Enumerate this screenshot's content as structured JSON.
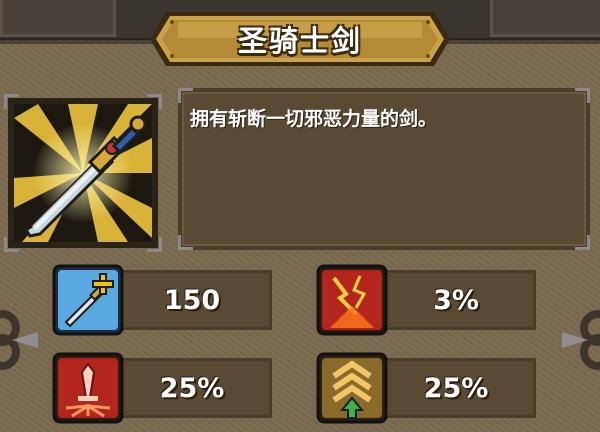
{
  "item": {
    "name": "圣骑士剑",
    "description": "拥有斩断一切邪恶力量的剑。"
  },
  "stats": [
    {
      "icon": "sword-plus-icon",
      "value": "150"
    },
    {
      "icon": "lightning-crit-icon",
      "value": "3%"
    },
    {
      "icon": "bleeding-dagger-icon",
      "value": "25%"
    },
    {
      "icon": "rank-up-chevrons-icon",
      "value": "25%"
    }
  ],
  "colors": {
    "panel": "#7a6a50",
    "banner_gold": "#c9a24a",
    "slot": "#5a4a34"
  }
}
